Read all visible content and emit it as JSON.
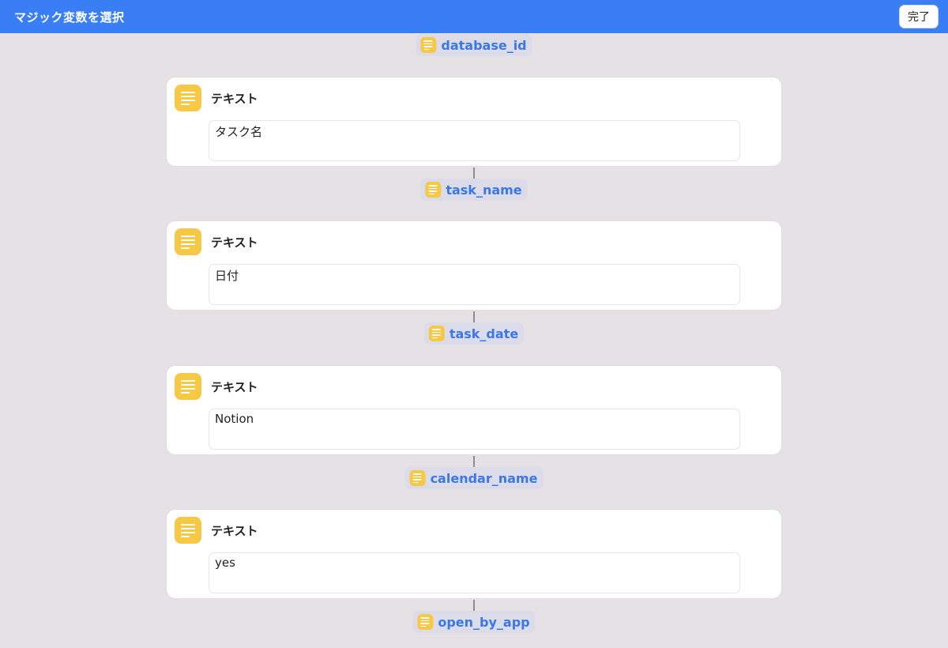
{
  "header": {
    "title": "マジック変数を選択",
    "done_label": "完了"
  },
  "variables": [
    {
      "name": "database_id",
      "icon": "text-lines-icon"
    },
    {
      "name": "task_name",
      "icon": "text-lines-icon"
    },
    {
      "name": "task_date",
      "icon": "text-lines-icon"
    },
    {
      "name": "calendar_name",
      "icon": "text-lines-icon"
    },
    {
      "name": "open_by_app",
      "icon": "text-lines-icon"
    }
  ],
  "actions": [
    {
      "title": "テキスト",
      "value": "タスク名",
      "icon": "text-lines-icon"
    },
    {
      "title": "テキスト",
      "value": "日付",
      "icon": "text-lines-icon"
    },
    {
      "title": "テキスト",
      "value": "Notion",
      "icon": "text-lines-icon"
    },
    {
      "title": "テキスト",
      "value": "yes",
      "icon": "text-lines-icon"
    }
  ],
  "colors": {
    "header_bg": "#3a7ef5",
    "canvas_bg": "#e6e1e5",
    "icon_yellow": "#f7c844",
    "variable_text": "#3a78e8",
    "pill_bg": "#dcdbe9"
  }
}
